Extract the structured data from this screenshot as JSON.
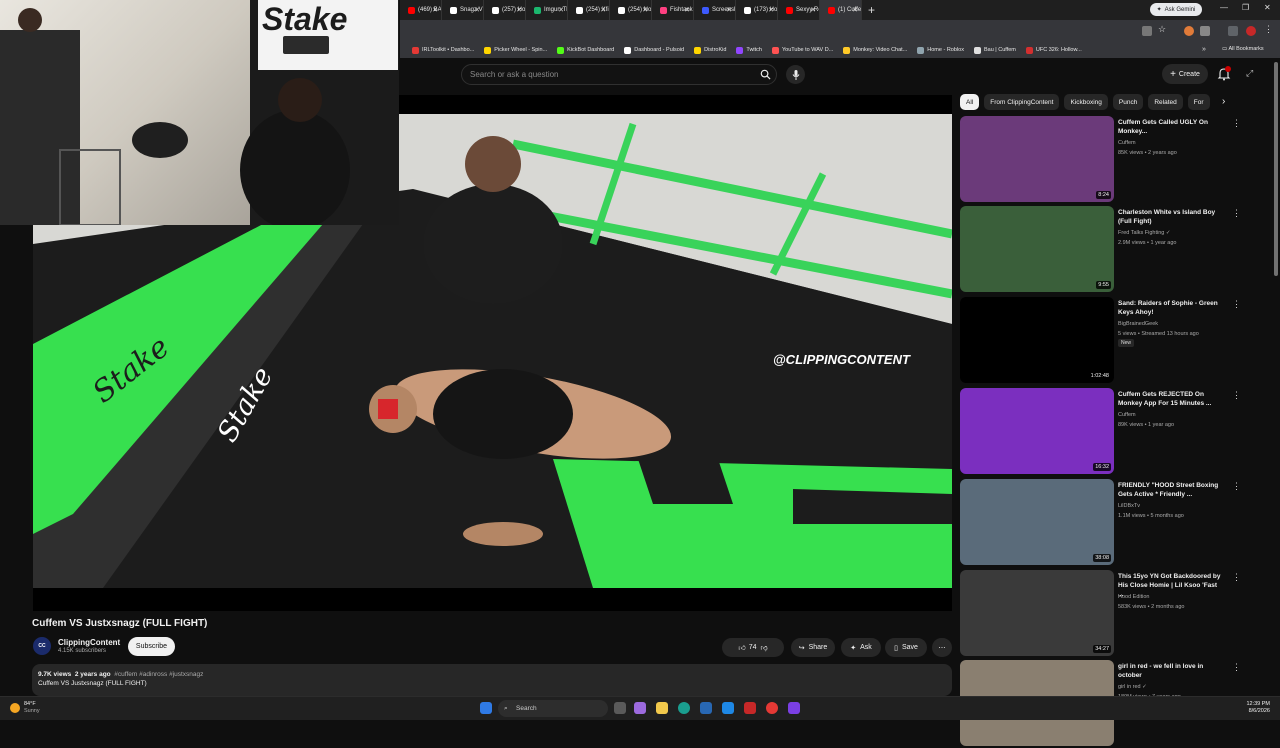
{
  "browser": {
    "tabs": [
      {
        "label": "(469) BAU",
        "color": "#ff0000"
      },
      {
        "label": "Snagz VS",
        "color": "#ffffff"
      },
      {
        "label": "(257) Hom",
        "color": "#ffffff"
      },
      {
        "label": "Imgur: The",
        "color": "#1bb76e"
      },
      {
        "label": "(254) Xfir",
        "color": "#ffffff"
      },
      {
        "label": "(254) Not",
        "color": "#ffffff"
      },
      {
        "label": "Fishtank.l",
        "color": "#ff4081"
      },
      {
        "label": "Screensho",
        "color": "#3d5afe"
      },
      {
        "label": "(173) Hon",
        "color": "#ffffff"
      },
      {
        "label": "Sexyy Red",
        "color": "#ff0000"
      },
      {
        "label": "(1) Cuffem",
        "color": "#ff0000"
      }
    ],
    "gemini_label": "Ask Gemini",
    "bookmarks": [
      {
        "label": "IRLToolkit • Dashbo...",
        "color": "#e53935"
      },
      {
        "label": "Picker Wheel - Spin...",
        "color": "#ffd600"
      },
      {
        "label": "KickBot Dashboard",
        "color": "#53fc18"
      },
      {
        "label": "Dashboard - Pulsoid",
        "color": "#ffffff"
      },
      {
        "label": "DistroKid",
        "color": "#ffd600"
      },
      {
        "label": "Twitch",
        "color": "#9146ff"
      },
      {
        "label": "YouTube to WAV D...",
        "color": "#ff5252"
      },
      {
        "label": "Monkey: Video Chat...",
        "color": "#ffca28"
      },
      {
        "label": "Home - Roblox",
        "color": "#90a4ae"
      },
      {
        "label": "Bau | Cuffem",
        "color": "#e0e0e0"
      },
      {
        "label": "UFC 326: Hollow...",
        "color": "#d32f2f"
      }
    ],
    "all_bookmarks": "All Bookmarks"
  },
  "header": {
    "search_placeholder": "Search or ask a question",
    "create_label": "Create",
    "notification_count": "9"
  },
  "video": {
    "watermark": "@CLIPPINGCONTENT",
    "title": "Cuffem VS Justxsnagz (FULL FIGHT)",
    "channel": "ClippingContent",
    "channel_avatar_text": "CC",
    "subscribers": "4.15K subscribers",
    "subscribe_label": "Subscribe",
    "likes": "74",
    "share_label": "Share",
    "ask_label": "Ask",
    "save_label": "Save",
    "views": "9.7K views",
    "age": "2 years ago",
    "tags": "#cuffem #adinross #justxsnagz",
    "description": "Cuffem VS Justxsnagz (FULL FIGHT)"
  },
  "chips": [
    "All",
    "From ClippingContent",
    "Kickboxing",
    "Punch",
    "Related",
    "For"
  ],
  "recommendations": [
    {
      "title": "Cuffem Gets Called UGLY On Monkey...",
      "channel": "Cuffem",
      "meta": "85K views • 2 years ago",
      "duration": "8:24",
      "bg": "#6b3a7a"
    },
    {
      "title": "Charleston White vs Island Boy (Full Fight)",
      "channel": "Fred Talks Fighting ✓",
      "meta": "2.9M views • 1 year ago",
      "duration": "9:55",
      "bg": "#3a5f3a"
    },
    {
      "title": "Sand: Raiders of Sophie - Green Keys Ahoy!",
      "channel": "BigBrainedGeek",
      "meta": "5 views • Streamed 13 hours ago",
      "duration": "1:02:48",
      "bg": "#000000",
      "badge": "New"
    },
    {
      "title": "Cuffem Gets REJECTED On Monkey App For 15 Minutes ...",
      "channel": "Cuffem",
      "meta": "89K views • 1 year ago",
      "duration": "16:32",
      "bg": "#7b2fbf"
    },
    {
      "title": "FRIENDLY \"HOOD Street Boxing Gets Active * Friendly ...",
      "channel": "LilDBxTv",
      "meta": "1.1M views • 5 months ago",
      "duration": "38:08",
      "bg": "#5a6b7a"
    },
    {
      "title": "This 15yo YN Got Backdoored by His Close Homie | Lil Ksoo 'Fast ...",
      "channel": "Hood Edition",
      "meta": "583K views • 2 months ago",
      "duration": "34:27",
      "bg": "#3a3a3a"
    },
    {
      "title": "girl in red - we fell in love in october",
      "channel": "girl in red ✓",
      "meta": "189M views • 7 years ago",
      "duration": "",
      "bg": "#8a7f70"
    }
  ],
  "taskbar": {
    "temp": "84°F",
    "weather": "Sunny",
    "search_label": "Search",
    "time": "12:39 PM",
    "date": "8/6/2026"
  }
}
